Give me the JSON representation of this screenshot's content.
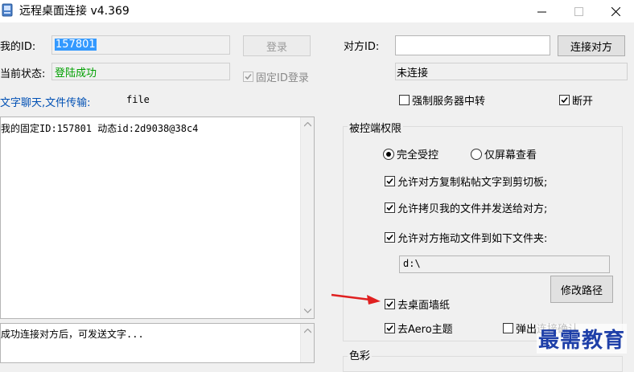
{
  "window": {
    "title": "远程桌面连接 v4.369"
  },
  "left": {
    "my_id_label": "我的ID:",
    "my_id_value": "157801",
    "login_button": "登录",
    "status_label": "当前状态:",
    "status_value": "登陆成功",
    "fixed_id_login_label": "固定ID登录",
    "chat_label": "文字聊天,文件传输:",
    "file_label": "file",
    "log_text": "我的固定ID:157801 动态id:2d9038@38c4",
    "message_text": "成功连接对方后，可发送文字..."
  },
  "right": {
    "peer_id_label": "对方ID:",
    "peer_id_value": "",
    "connect_button": "连接对方",
    "connection_status": "未连接",
    "force_server_relay_label": "强制服务器中转",
    "disconnect_label": "断开",
    "permissions_group_title": "被控端权限",
    "radio_full_control": "完全受控",
    "radio_view_only": "仅屏幕查看",
    "allow_clipboard_label": "允许对方复制粘帖文字到剪切板;",
    "allow_copy_files_label": "允许拷贝我的文件并发送给对方;",
    "allow_drag_files_label": "允许对方拖动文件到如下文件夹:",
    "folder_path": "d:\\",
    "change_path_button": "修改路径",
    "remove_wallpaper_label": "去桌面墙纸",
    "remove_aero_label": "去Aero主题",
    "popup_label": "弹出连接确认",
    "color_group_title": "色彩"
  },
  "watermark": "最需教育",
  "colors": {
    "selection": "#3399ff",
    "status_green": "#00a000",
    "link_blue": "#0050b4",
    "arrow_red": "#e02020",
    "watermark_blue": "#1e3fa8"
  }
}
